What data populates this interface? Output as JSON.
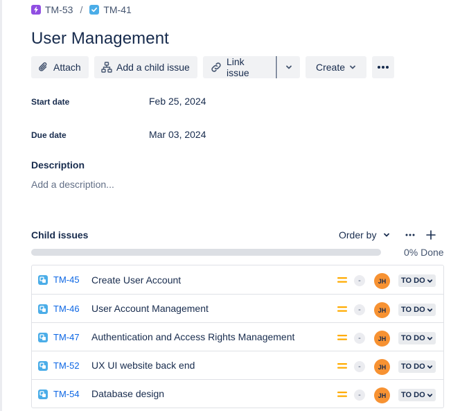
{
  "breadcrumb": {
    "parent_key": "TM-53",
    "separator": "/",
    "current_key": "TM-41",
    "parent_icon": "epic-lightning-icon",
    "current_icon": "task-checkbox-icon"
  },
  "title": "User Management",
  "toolbar": {
    "attach_label": "Attach",
    "add_child_label": "Add a child issue",
    "link_issue_label": "Link issue",
    "create_label": "Create"
  },
  "fields": {
    "start_date_label": "Start date",
    "start_date_value": "Feb 25, 2024",
    "due_date_label": "Due date",
    "due_date_value": "Mar 03, 2024"
  },
  "description": {
    "label": "Description",
    "placeholder": "Add a description..."
  },
  "child_issues": {
    "label": "Child issues",
    "order_by_label": "Order by",
    "progress_percent": 0,
    "progress_text": "0% Done",
    "items": [
      {
        "key": "TM-45",
        "summary": "Create User Account",
        "estimate": "-",
        "assignee_initials": "JH",
        "status": "TO DO"
      },
      {
        "key": "TM-46",
        "summary": "User Account Management",
        "estimate": "-",
        "assignee_initials": "JH",
        "status": "TO DO"
      },
      {
        "key": "TM-47",
        "summary": "Authentication and Access Rights Management",
        "estimate": "-",
        "assignee_initials": "JH",
        "status": "TO DO"
      },
      {
        "key": "TM-52",
        "summary": "UX UI website back end",
        "estimate": "-",
        "assignee_initials": "JH",
        "status": "TO DO"
      },
      {
        "key": "TM-54",
        "summary": "Database design",
        "estimate": "-",
        "assignee_initials": "JH",
        "status": "TO DO"
      }
    ]
  },
  "colors": {
    "epic": "#904ee2",
    "task": "#4bade8",
    "link": "#0c66e4",
    "priority_medium": "#ffab00",
    "avatar": "#f79232"
  }
}
